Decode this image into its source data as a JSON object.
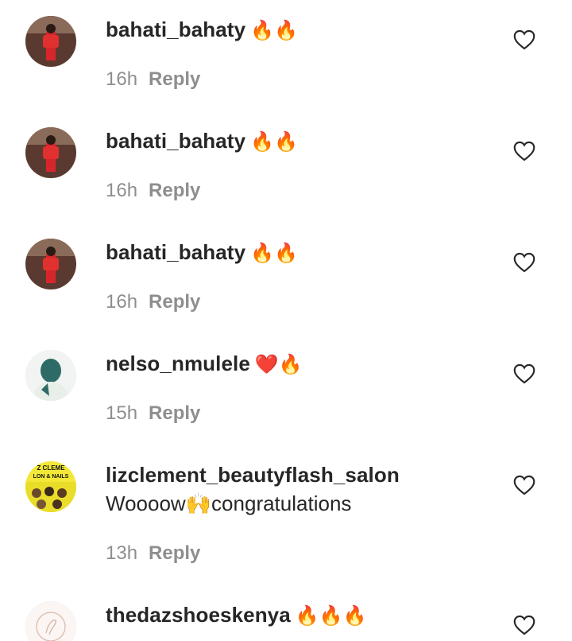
{
  "comments": [
    {
      "username": "bahati_bahaty",
      "emoji": "🔥🔥",
      "text": "",
      "time": "16h",
      "reply": "Reply"
    },
    {
      "username": "bahati_bahaty",
      "emoji": "🔥🔥",
      "text": "",
      "time": "16h",
      "reply": "Reply"
    },
    {
      "username": "bahati_bahaty",
      "emoji": "🔥🔥",
      "text": "",
      "time": "16h",
      "reply": "Reply"
    },
    {
      "username": "nelso_nmulele",
      "emoji": "❤️🔥",
      "text": "",
      "time": "15h",
      "reply": "Reply"
    },
    {
      "username": "lizclement_beautyflash_salon",
      "emoji": "",
      "text": "Woooow🙌congratulations",
      "time": "13h",
      "reply": "Reply"
    },
    {
      "username": "thedazshoeskenya",
      "emoji": "🔥🔥🔥",
      "text": "",
      "time": "",
      "reply": ""
    }
  ],
  "avatars": {
    "salon_sign": "Z CLEME\nLON & NAILS"
  },
  "colors": {
    "text_primary": "#262626",
    "text_secondary": "#8e8e8e",
    "accent_red": "#d7262b",
    "avatar_green": "#2e6b66",
    "avatar_yellow": "#f3e838"
  },
  "icons": {
    "like": "heart-outline-icon"
  }
}
